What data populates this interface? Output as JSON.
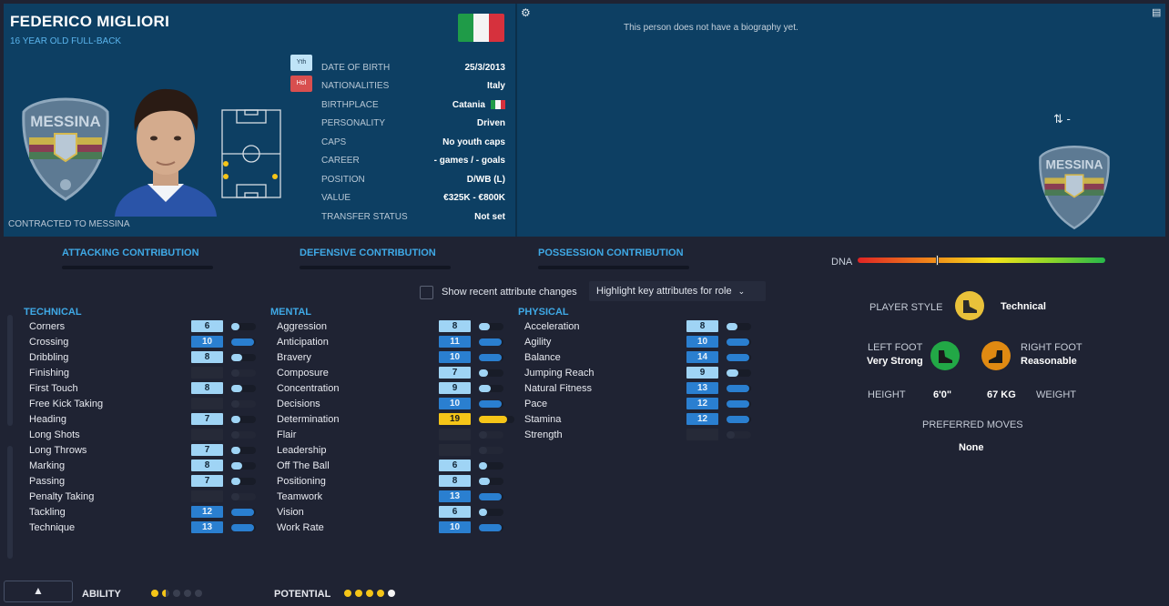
{
  "player": {
    "name": "FEDERICO MIGLIORI",
    "subtitle": "16 YEAR OLD FULL-BACK",
    "contract": "CONTRACTED TO MESSINA",
    "bio": "This person does not have a biography yet.",
    "tag_youth": "Yth",
    "tag_hol": "Hol",
    "club_crest_text": "MESSINA",
    "swap_value": "-"
  },
  "info": [
    {
      "label": "DATE OF BIRTH",
      "value": "25/3/2013"
    },
    {
      "label": "NATIONALITIES",
      "value": "Italy"
    },
    {
      "label": "BIRTHPLACE",
      "value": "Catania"
    },
    {
      "label": "PERSONALITY",
      "value": "Driven"
    },
    {
      "label": "CAPS",
      "value": "No youth caps"
    },
    {
      "label": "CAREER",
      "value": "- games /    -  goals"
    },
    {
      "label": "POSITION",
      "value": "D/WB (L)"
    },
    {
      "label": "VALUE",
      "value": "€325K - €800K"
    },
    {
      "label": "TRANSFER STATUS",
      "value": "Not set"
    }
  ],
  "contributions": {
    "attacking": "ATTACKING CONTRIBUTION",
    "defensive": "DEFENSIVE CONTRIBUTION",
    "possession": "POSSESSION CONTRIBUTION"
  },
  "dna": {
    "label": "DNA",
    "value": 0.32
  },
  "controls": {
    "show_recent": "Show recent attribute changes",
    "highlight": "Highlight key attributes for role"
  },
  "technical": {
    "title": "TECHNICAL",
    "items": [
      {
        "name": "Corners",
        "value": "6"
      },
      {
        "name": "Crossing",
        "value": "10"
      },
      {
        "name": "Dribbling",
        "value": "8"
      },
      {
        "name": "Finishing",
        "value": ""
      },
      {
        "name": "First Touch",
        "value": "8"
      },
      {
        "name": "Free Kick Taking",
        "value": ""
      },
      {
        "name": "Heading",
        "value": "7"
      },
      {
        "name": "Long Shots",
        "value": ""
      },
      {
        "name": "Long Throws",
        "value": "7"
      },
      {
        "name": "Marking",
        "value": "8"
      },
      {
        "name": "Passing",
        "value": "7"
      },
      {
        "name": "Penalty Taking",
        "value": ""
      },
      {
        "name": "Tackling",
        "value": "12"
      },
      {
        "name": "Technique",
        "value": "13"
      }
    ]
  },
  "mental": {
    "title": "MENTAL",
    "items": [
      {
        "name": "Aggression",
        "value": "8"
      },
      {
        "name": "Anticipation",
        "value": "11"
      },
      {
        "name": "Bravery",
        "value": "10"
      },
      {
        "name": "Composure",
        "value": "7"
      },
      {
        "name": "Concentration",
        "value": "9"
      },
      {
        "name": "Decisions",
        "value": "10"
      },
      {
        "name": "Determination",
        "value": "19"
      },
      {
        "name": "Flair",
        "value": ""
      },
      {
        "name": "Leadership",
        "value": ""
      },
      {
        "name": "Off The Ball",
        "value": "6"
      },
      {
        "name": "Positioning",
        "value": "8"
      },
      {
        "name": "Teamwork",
        "value": "13"
      },
      {
        "name": "Vision",
        "value": "6"
      },
      {
        "name": "Work Rate",
        "value": "10"
      }
    ]
  },
  "physical": {
    "title": "PHYSICAL",
    "items": [
      {
        "name": "Acceleration",
        "value": "8"
      },
      {
        "name": "Agility",
        "value": "10"
      },
      {
        "name": "Balance",
        "value": "14"
      },
      {
        "name": "Jumping Reach",
        "value": "9"
      },
      {
        "name": "Natural Fitness",
        "value": "13"
      },
      {
        "name": "Pace",
        "value": "12"
      },
      {
        "name": "Stamina",
        "value": "12"
      },
      {
        "name": "Strength",
        "value": ""
      }
    ]
  },
  "profile": {
    "player_style_label": "PLAYER STYLE",
    "player_style": "Technical",
    "left_foot_label": "LEFT FOOT",
    "left_foot": "Very Strong",
    "right_foot_label": "RIGHT FOOT",
    "right_foot": "Reasonable",
    "height_label": "HEIGHT",
    "height": "6'0\"",
    "weight": "67 KG",
    "weight_label": "WEIGHT",
    "preferred_moves_label": "PREFERRED MOVES",
    "preferred_moves": "None"
  },
  "footer": {
    "ability_label": "ABILITY",
    "ability_stars": 1.5,
    "potential_label": "POTENTIAL",
    "potential_stars": 4.5
  },
  "colors": {
    "header_bg": "#0d3f63",
    "accent": "#3fa9e6",
    "gold": "#f5c518",
    "left_foot": "#22a846",
    "right_foot": "#e08a12"
  }
}
